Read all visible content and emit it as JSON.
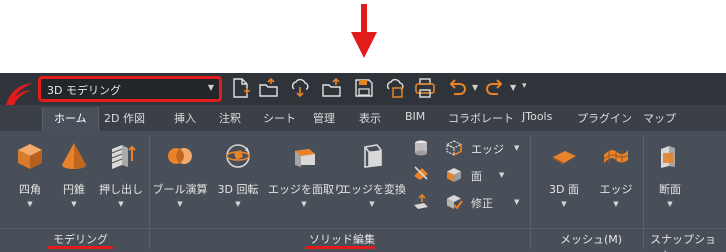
{
  "workspace": {
    "selected": "3D モデリング"
  },
  "tabs": [
    "ホーム",
    "2D 作図",
    "挿入",
    "注釈",
    "シート",
    "管理",
    "表示",
    "BIM",
    "コラボレート",
    "JTools",
    "プラグイン",
    "マップ"
  ],
  "modeling": {
    "title": "モデリング",
    "buttons": [
      "四角",
      "円錐",
      "押し出し"
    ]
  },
  "solid_edit": {
    "title": "ソリッド編集",
    "buttons": [
      "ブール演算",
      "3D 回転",
      "エッジを面取り",
      "エッジを変換"
    ],
    "small": [
      "エッジ",
      "面",
      "修正"
    ]
  },
  "mesh": {
    "title": "メッシュ(M)",
    "buttons": [
      "3D 面",
      "エッジ"
    ]
  },
  "snapshot": {
    "title": "スナップショット",
    "buttons": [
      "断面"
    ]
  },
  "colors": {
    "accent": "#e21b1b",
    "icon_orange": "#e8832a",
    "ribbon_bg": "#494f58"
  }
}
